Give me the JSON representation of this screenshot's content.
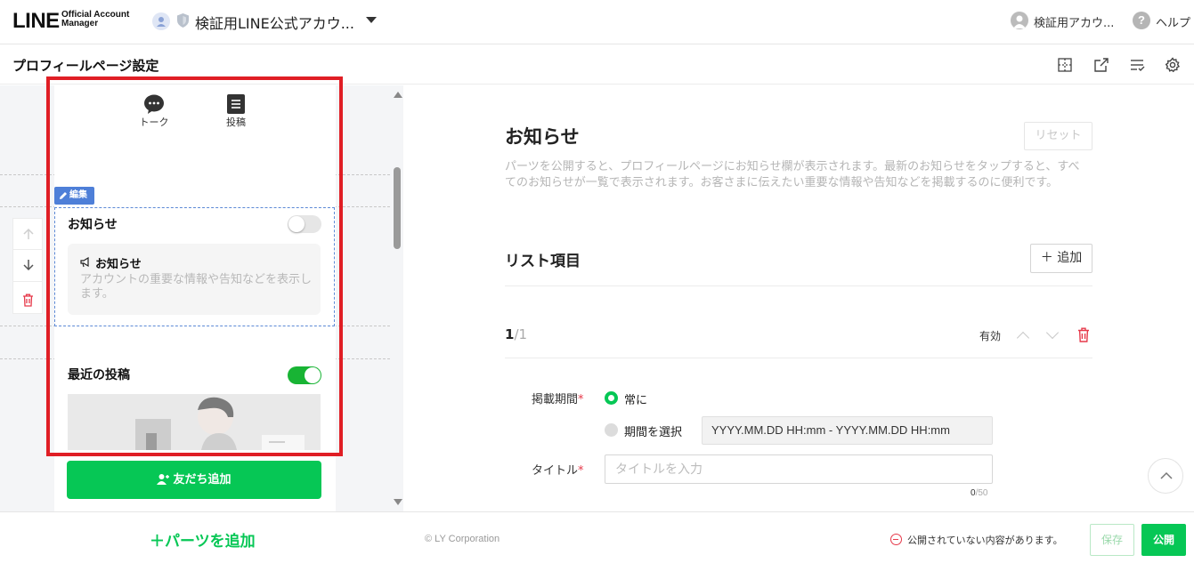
{
  "topbar": {
    "logo_main": "LINE",
    "logo_sub_1": "Official Account",
    "logo_sub_2": "Manager",
    "account_name": "検証用LINE公式アカウ...",
    "user_name": "検証用アカウ...",
    "help_label": "ヘルプ",
    "help_icon_glyph": "?"
  },
  "page_header": {
    "title": "プロフィールページ設定",
    "icons": [
      "layout-icon",
      "external-link-icon",
      "list-edit-icon",
      "settings-icon"
    ]
  },
  "preview": {
    "tabs": [
      {
        "label": "トーク",
        "icon": "chat-icon"
      },
      {
        "label": "投稿",
        "icon": "post-icon"
      }
    ],
    "edit_badge": "編集",
    "notice_section": {
      "title": "お知らせ",
      "toggle_on": false,
      "card_title": "お知らせ",
      "card_desc": "アカウントの重要な情報や告知などを表示します。"
    },
    "posts_section": {
      "title": "最近の投稿",
      "toggle_on": true
    },
    "add_friend_label": "友だち追加",
    "add_parts_label": "＋パーツを追加"
  },
  "editor": {
    "title": "お知らせ",
    "reset_label": "リセット",
    "description": "パーツを公開すると、プロフィールページにお知らせ欄が表示されます。最新のお知らせをタップすると、すべてのお知らせが一覧で表示されます。お客さまに伝えたい重要な情報や告知などを掲載するのに便利です。",
    "list_title": "リスト項目",
    "add_label": "＋ 追加",
    "item_index": "1",
    "item_total": "/1",
    "valid_label": "有効",
    "period_label": "掲載期間",
    "required_mark": "*",
    "period_options": [
      {
        "label": "常に",
        "selected": true
      },
      {
        "label": "期間を選択",
        "selected": false
      }
    ],
    "date_range_placeholder": "YYYY.MM.DD HH:mm - YYYY.MM.DD HH:mm",
    "title_label": "タイトル",
    "title_placeholder": "タイトルを入力",
    "title_value": "",
    "char_count": "0",
    "char_max": "/50"
  },
  "footer": {
    "copyright": "© LY Corporation",
    "unpublished_notice": "公開されていない内容があります。",
    "save_label": "保存",
    "publish_label": "公開"
  },
  "colors": {
    "line_green": "#06c755",
    "toggle_green": "#18b434",
    "highlight_red": "#e01e25",
    "edit_blue": "#4e7fd8"
  }
}
